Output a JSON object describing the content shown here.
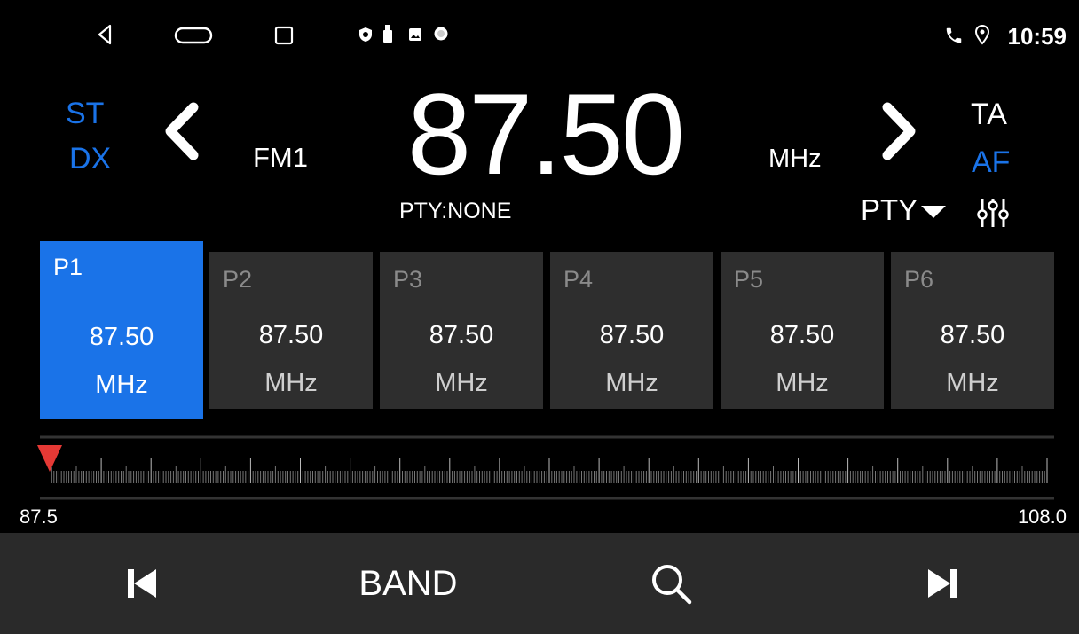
{
  "status_bar": {
    "time": "10:59",
    "nav_icons": [
      "back-icon",
      "home-icon",
      "recents-icon"
    ],
    "notification_icons": [
      "shield-icon",
      "usb-icon",
      "image-icon",
      "record-icon"
    ],
    "status_icons": [
      "phone-icon",
      "location-icon"
    ]
  },
  "radio": {
    "left_modes": [
      "ST",
      "DX"
    ],
    "right_modes": [
      "TA",
      "AF"
    ],
    "band": "FM1",
    "frequency": "87.50",
    "unit": "MHz",
    "pty_info": "PTY:NONE",
    "pty_button": "PTY",
    "colors": {
      "accent": "#1a73e8",
      "preset_bg": "#2e2e2e",
      "bar_bg": "#2a2a2a",
      "marker": "#e53935"
    }
  },
  "presets": [
    {
      "name": "P1",
      "freq": "87.50",
      "unit": "MHz",
      "active": true
    },
    {
      "name": "P2",
      "freq": "87.50",
      "unit": "MHz",
      "active": false
    },
    {
      "name": "P3",
      "freq": "87.50",
      "unit": "MHz",
      "active": false
    },
    {
      "name": "P4",
      "freq": "87.50",
      "unit": "MHz",
      "active": false
    },
    {
      "name": "P5",
      "freq": "87.50",
      "unit": "MHz",
      "active": false
    },
    {
      "name": "P6",
      "freq": "87.50",
      "unit": "MHz",
      "active": false
    }
  ],
  "scale": {
    "min": "87.5",
    "max": "108.0",
    "current": 87.5
  },
  "bottom_bar": {
    "band_label": "BAND",
    "icons": [
      "skip-previous-icon",
      "search-icon",
      "skip-next-icon"
    ]
  }
}
